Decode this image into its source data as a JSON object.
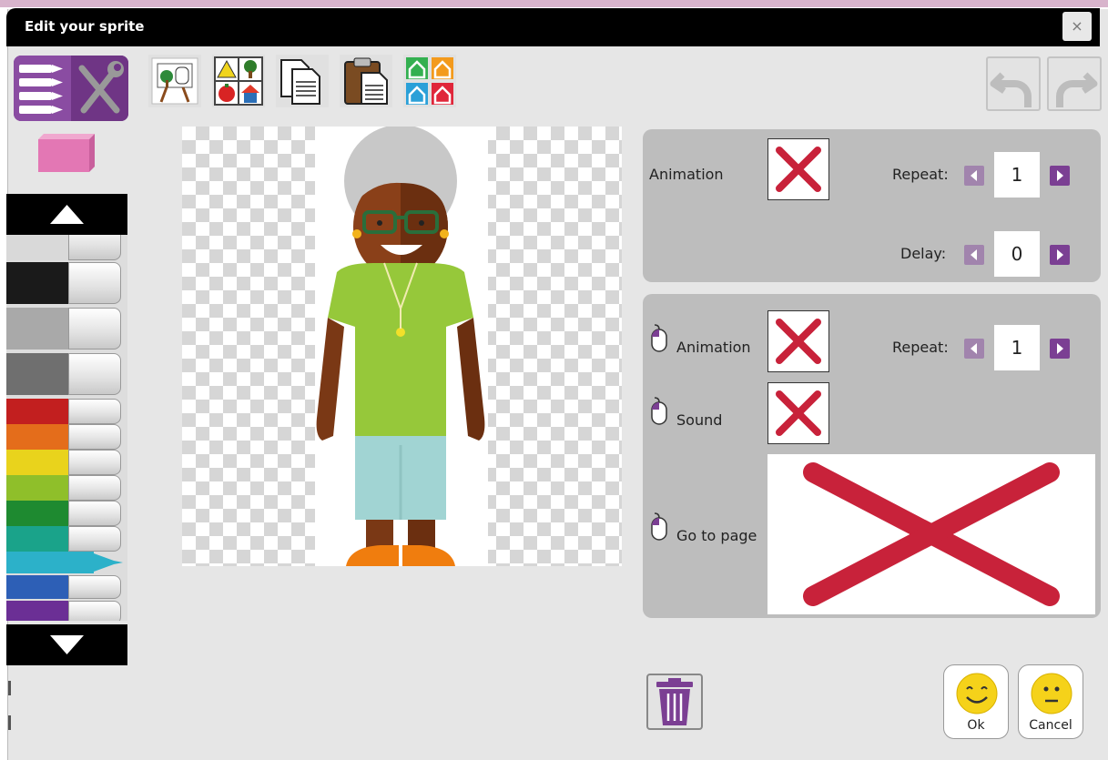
{
  "window": {
    "title": "Edit your sprite",
    "close": "×"
  },
  "toolbar": {
    "icons": [
      "background-picker-icon",
      "shapes-library-icon",
      "copy-icon",
      "paste-icon",
      "flip-frames-icon"
    ]
  },
  "palette": {
    "pen_colors": [
      "#d9d9d9",
      "#1a1a1a",
      "#a9a9a9",
      "#6f6f6f",
      "#c21f1f",
      "#e46d1b",
      "#e9d31c",
      "#8fbf2a",
      "#1e8a30",
      "#1aa38a",
      "#2cb1c9",
      "#2d5fb6",
      "#6b2f95"
    ]
  },
  "animation_panel": {
    "animation_label": "Animation",
    "repeat_label": "Repeat:",
    "repeat_value": "1",
    "delay_label": "Delay:",
    "delay_value": "0"
  },
  "click_panel": {
    "animation_label": "Animation",
    "repeat_label": "Repeat:",
    "repeat_value": "1",
    "sound_label": "Sound",
    "goto_label": "Go to page"
  },
  "footer": {
    "ok_label": "Ok",
    "cancel_label": "Cancel"
  },
  "colors": {
    "accent": "#7b3f93",
    "x_red": "#c8223a"
  }
}
